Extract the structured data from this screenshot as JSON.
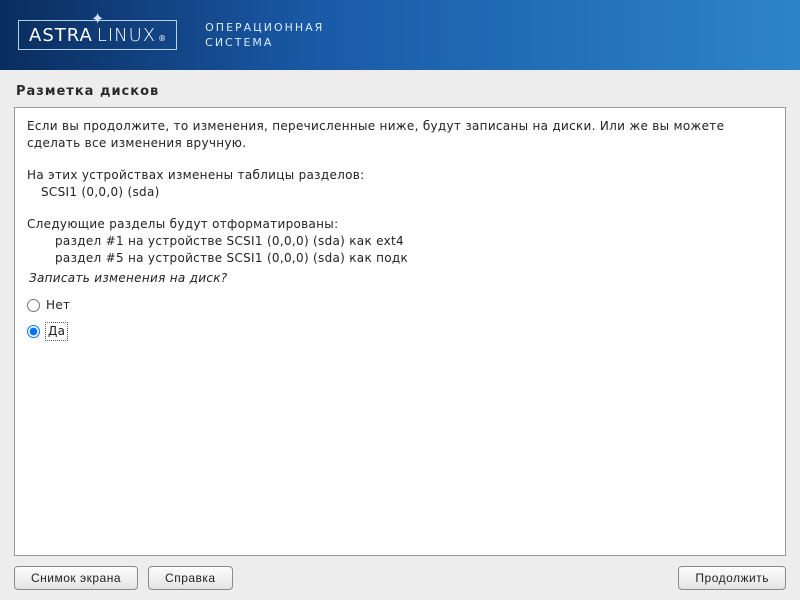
{
  "header": {
    "logo_astra": "ASTRA",
    "logo_linux": "LINUX",
    "logo_reg": "®",
    "subtitle_line1": "ОПЕРАЦИОННАЯ",
    "subtitle_line2": "СИСТЕМА"
  },
  "page_title": "Разметка дисков",
  "content": {
    "intro": "Если вы продолжите, то изменения, перечисленные ниже, будут записаны на диски. Или же вы можете сделать все изменения вручную.",
    "devices_heading": "На этих устройствах изменены таблицы разделов:",
    "device_1": "SCSI1 (0,0,0) (sda)",
    "format_heading": "Следующие разделы будут отформатированы:",
    "format_1": "раздел #1 на устройстве SCSI1 (0,0,0) (sda) как ext4",
    "format_2": "раздел #5 на устройстве SCSI1 (0,0,0) (sda) как подк",
    "question": "Записать изменения на диск?",
    "option_no": "Нет",
    "option_yes": "Да",
    "selected": "yes"
  },
  "footer": {
    "screenshot": "Снимок экрана",
    "help": "Справка",
    "continue": "Продолжить"
  }
}
